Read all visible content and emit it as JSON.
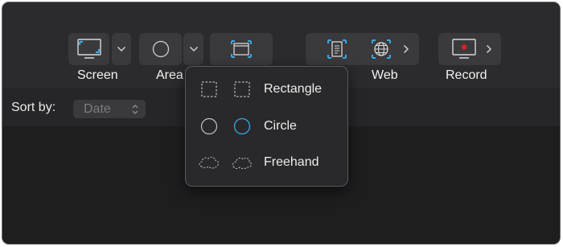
{
  "toolbar": {
    "screen_label": "Screen",
    "area_label": "Area",
    "web_label": "Web",
    "record_label": "Record"
  },
  "sort": {
    "label": "Sort by:",
    "selected": "Date"
  },
  "area_menu": {
    "options": [
      {
        "label": "Rectangle"
      },
      {
        "label": "Circle"
      },
      {
        "label": "Freehand"
      }
    ]
  },
  "icons": {
    "screen": "monitor-icon",
    "area": "circle-icon",
    "window": "window-icon",
    "scrolling": "document-icon",
    "web": "globe-icon",
    "record": "record-icon",
    "dropdown": "chevron-down-icon",
    "submenu": "chevron-right-icon"
  },
  "colors": {
    "accent": "#3aa7e8",
    "record_red": "#e02020",
    "window_bg": "#2b2b2d",
    "button_bg": "#3a3a3c"
  }
}
